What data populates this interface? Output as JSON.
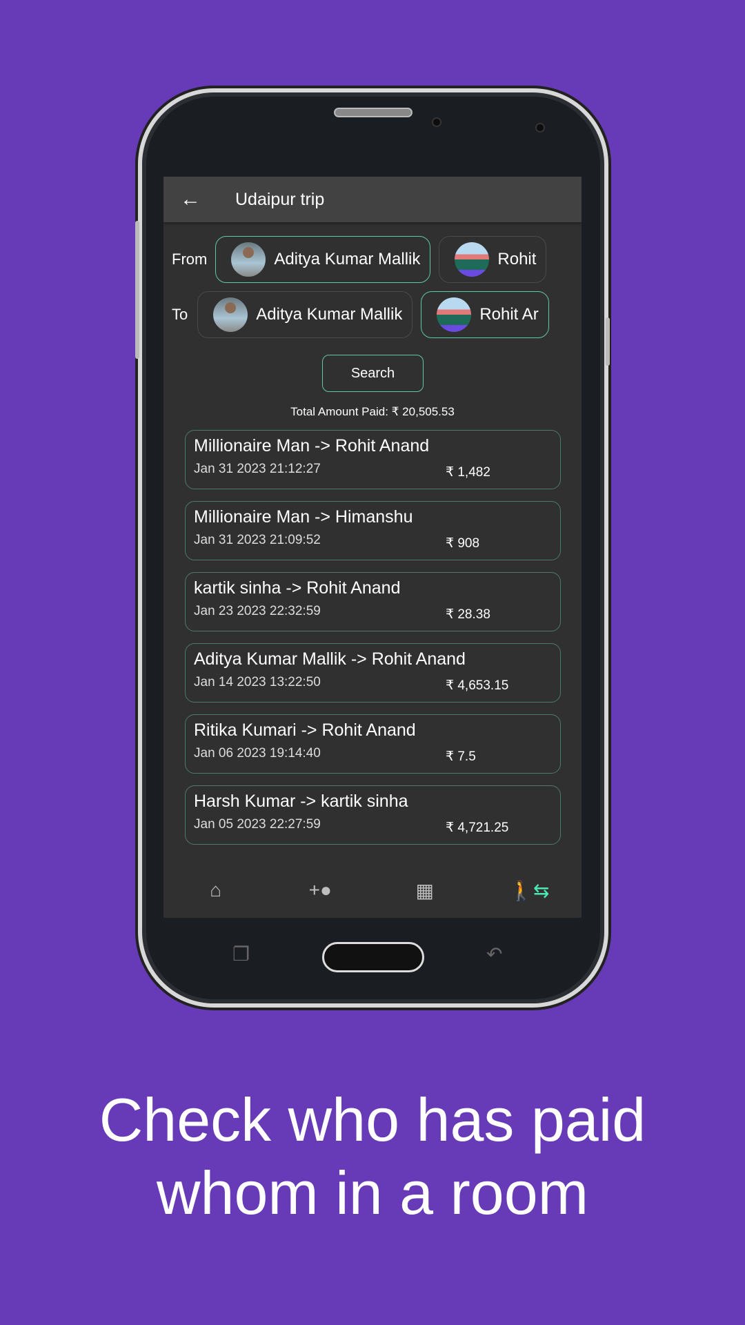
{
  "app": {
    "title": "Udaipur trip",
    "back_icon": "arrow-left-icon"
  },
  "filters": {
    "from_label": "From",
    "to_label": "To",
    "from_chips": [
      {
        "name": "Aditya Kumar Mallik",
        "selected": true
      },
      {
        "name": "Rohit",
        "selected": false
      }
    ],
    "to_chips": [
      {
        "name": "Aditya Kumar Mallik",
        "selected": false
      },
      {
        "name": "Rohit Ar",
        "selected": true
      }
    ],
    "search_label": "Search"
  },
  "total": "Total Amount Paid: ₹ 20,505.53",
  "transactions": [
    {
      "names": "Millionaire Man -> Rohit Anand",
      "date": "Jan 31 2023 21:12:27",
      "amount": "₹ 1,482"
    },
    {
      "names": "Millionaire Man -> Himanshu",
      "date": "Jan 31 2023 21:09:52",
      "amount": "₹ 908"
    },
    {
      "names": "kartik sinha -> Rohit Anand",
      "date": "Jan 23 2023 22:32:59",
      "amount": "₹ 28.38"
    },
    {
      "names": "Aditya Kumar Mallik -> Rohit Anand",
      "date": "Jan 14 2023 13:22:50",
      "amount": "₹ 4,653.15"
    },
    {
      "names": "Ritika Kumari -> Rohit Anand",
      "date": "Jan 06 2023 19:14:40",
      "amount": "₹ 7.5"
    },
    {
      "names": "Harsh Kumar -> kartik sinha",
      "date": "Jan 05 2023 22:27:59",
      "amount": "₹ 4,721.25"
    }
  ],
  "bottom_nav": [
    {
      "icon": "home-icon"
    },
    {
      "icon": "add-person-icon"
    },
    {
      "icon": "chart-icon"
    },
    {
      "icon": "payments-transfer-icon",
      "active": true
    }
  ],
  "colors": {
    "background": "#673ab7",
    "accent": "#4de8b5",
    "screen": "#303030"
  },
  "caption": {
    "line1": "Check who has paid",
    "line2": "whom in a room"
  }
}
